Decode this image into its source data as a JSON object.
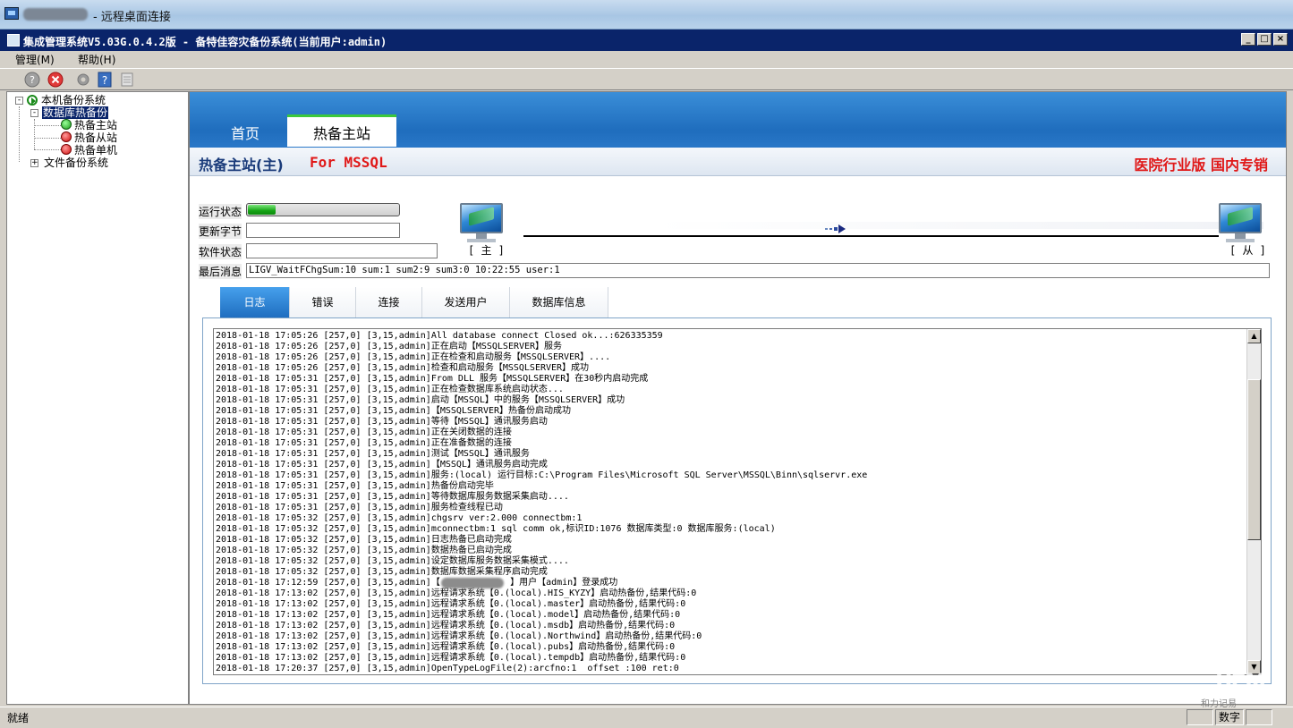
{
  "rdp": {
    "title": "- 远程桌面连接"
  },
  "app": {
    "title": "集成管理系统V5.03G.0.4.2版  - 备特佳容灾备份系统(当前用户:admin)",
    "min_glyph": "_",
    "max_glyph": "□",
    "close_glyph": "×"
  },
  "menu": {
    "items": [
      "管理(M)",
      "帮助(H)"
    ]
  },
  "toolbar": {
    "icons": [
      "help-icon",
      "close-icon",
      "settings-icon",
      "question-icon",
      "document-icon"
    ]
  },
  "tree": {
    "root": "本机备份系统",
    "db_node": "数据库热备份",
    "children": [
      "热备主站",
      "热备从站",
      "热备单机"
    ],
    "file_node": "文件备份系统",
    "expander_open": "-",
    "expander_closed": "+"
  },
  "main_tabs": [
    "首页",
    "热备主站"
  ],
  "header": {
    "title": "热备主站(主)",
    "subtitle": "For MSSQL",
    "edition": "医院行业版  国内专销"
  },
  "status": {
    "run_label": "运行状态",
    "run_progress": 0.18,
    "bytes_label": "更新字节",
    "bytes_value": "",
    "software_label": "软件状态",
    "software_value": "",
    "last_msg_label": "最后消息",
    "last_msg_value": "LIGV_WaitFChgSum:10 sum:1 sum2:9 sum3:0 10:22:55 user:1"
  },
  "nodes": {
    "master_label": "[ 主 ]",
    "slave_label": "[ 从 ]"
  },
  "log_tabs": [
    "日志",
    "错误",
    "连接",
    "发送用户",
    "数据库信息"
  ],
  "log": [
    "2018-01-18 17:05:26 [257,0] [3,15,admin]All database connect Closed ok...:626335359",
    "2018-01-18 17:05:26 [257,0] [3,15,admin]正在启动【MSSQLSERVER】服务",
    "2018-01-18 17:05:26 [257,0] [3,15,admin]正在检查和启动服务【MSSQLSERVER】....",
    "2018-01-18 17:05:26 [257,0] [3,15,admin]检查和启动服务【MSSQLSERVER】成功",
    "2018-01-18 17:05:31 [257,0] [3,15,admin]From DLL 服务【MSSQLSERVER】在30秒内启动完成",
    "2018-01-18 17:05:31 [257,0] [3,15,admin]正在检查数据库系统启动状态...",
    "2018-01-18 17:05:31 [257,0] [3,15,admin]启动【MSSQL】中的服务【MSSQLSERVER】成功",
    "2018-01-18 17:05:31 [257,0] [3,15,admin]【MSSQLSERVER】热备份启动成功",
    "2018-01-18 17:05:31 [257,0] [3,15,admin]等待【MSSQL】通讯服务启动",
    "2018-01-18 17:05:31 [257,0] [3,15,admin]正在关闭数据的连接",
    "2018-01-18 17:05:31 [257,0] [3,15,admin]正在准备数据的连接",
    "2018-01-18 17:05:31 [257,0] [3,15,admin]测试【MSSQL】通讯服务",
    "2018-01-18 17:05:31 [257,0] [3,15,admin]【MSSQL】通讯服务启动完成",
    "2018-01-18 17:05:31 [257,0] [3,15,admin]服务:(local) 运行目标:C:\\Program Files\\Microsoft SQL Server\\MSSQL\\Binn\\sqlservr.exe",
    "2018-01-18 17:05:31 [257,0] [3,15,admin]热备份启动完毕",
    "2018-01-18 17:05:31 [257,0] [3,15,admin]等待数据库服务数据采集启动....",
    "2018-01-18 17:05:31 [257,0] [3,15,admin]服务检查线程已动",
    "2018-01-18 17:05:32 [257,0] [3,15,admin]chgsrv ver:2.000 connectbm:1",
    "2018-01-18 17:05:32 [257,0] [3,15,admin]mconnectbm:1 sql comm ok,标识ID:1076 数据库类型:0 数据库服务:(local)",
    "2018-01-18 17:05:32 [257,0] [3,15,admin]日志热备已启动完成",
    "2018-01-18 17:05:32 [257,0] [3,15,admin]数据热备已启动完成",
    "2018-01-18 17:05:32 [257,0] [3,15,admin]设定数据库服务数据采集模式....",
    "2018-01-18 17:05:32 [257,0] [3,15,admin]数据库数据采集程序启动完成",
    "2018-01-18 17:12:59 [257,0] [3,15,admin]【             】用户【admin】登录成功",
    "2018-01-18 17:13:02 [257,0] [3,15,admin]远程请求系统【0.(local).HIS_KYZY】启动热备份,结果代码:0",
    "2018-01-18 17:13:02 [257,0] [3,15,admin]远程请求系统【0.(local).master】启动热备份,结果代码:0",
    "2018-01-18 17:13:02 [257,0] [3,15,admin]远程请求系统【0.(local).model】启动热备份,结果代码:0",
    "2018-01-18 17:13:02 [257,0] [3,15,admin]远程请求系统【0.(local).msdb】启动热备份,结果代码:0",
    "2018-01-18 17:13:02 [257,0] [3,15,admin]远程请求系统【0.(local).Northwind】启动热备份,结果代码:0",
    "2018-01-18 17:13:02 [257,0] [3,15,admin]远程请求系统【0.(local).pubs】启动热备份,结果代码:0",
    "2018-01-18 17:13:02 [257,0] [3,15,admin]远程请求系统【0.(local).tempdb】启动热备份,结果代码:0",
    "2018-01-18 17:20:37 [257,0] [3,15,admin]OpenTypeLogFile(2):arcfno:1  offset :100 ret:0"
  ],
  "statusbar": {
    "text": "就绪",
    "num_label": "数字"
  },
  "watermark": {
    "logo": "UPM",
    "sub": "和力记易"
  }
}
